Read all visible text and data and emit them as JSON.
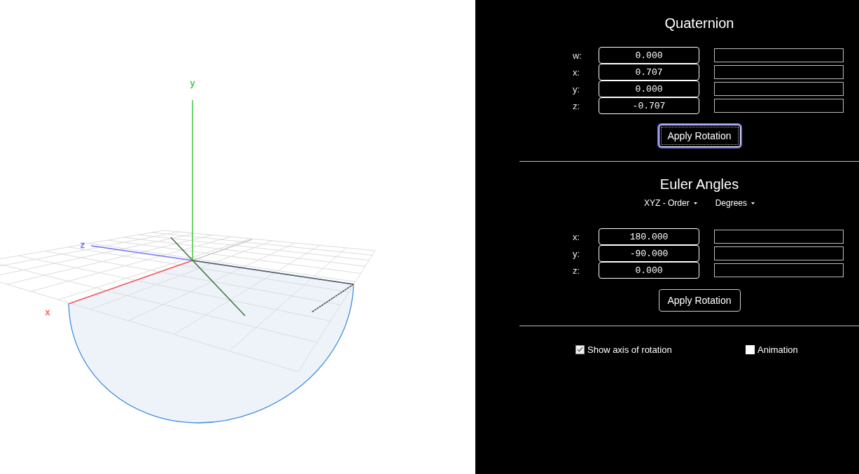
{
  "scene": {
    "axis_labels": [
      {
        "label": "y",
        "color": "#4ccc4c"
      },
      {
        "label": "z",
        "color": "#7070ff"
      },
      {
        "label": "x",
        "color": "#ff6060"
      }
    ]
  },
  "quaternion": {
    "title": "Quaternion",
    "fields": [
      {
        "label": "w:",
        "value": "0.000"
      },
      {
        "label": "x:",
        "value": "0.707"
      },
      {
        "label": "y:",
        "value": "0.000"
      },
      {
        "label": "z:",
        "value": "-0.707"
      }
    ],
    "apply_button": {
      "label": "Apply Rotation",
      "focused": true
    }
  },
  "euler": {
    "title": "Euler Angles",
    "dropdowns": [
      {
        "label": "XYZ - Order"
      },
      {
        "label": "Degrees"
      }
    ],
    "fields": [
      {
        "label": "x:",
        "value": "180.000"
      },
      {
        "label": "y:",
        "value": "-90.000"
      },
      {
        "label": "z:",
        "value": "0.000"
      }
    ],
    "apply_button": {
      "label": "Apply Rotation",
      "focused": false
    }
  },
  "options": [
    {
      "label": "Show axis of rotation",
      "checked": true
    },
    {
      "label": "Animation",
      "checked": false
    }
  ]
}
